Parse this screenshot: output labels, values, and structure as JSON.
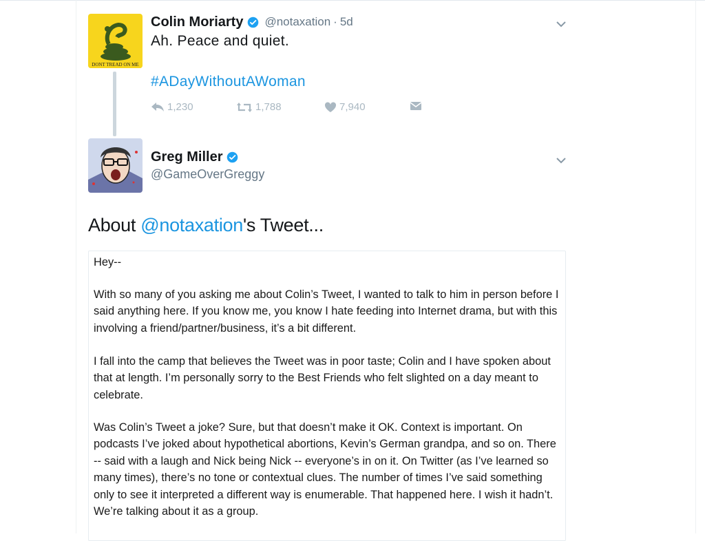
{
  "tweet": {
    "author_name": "Colin Moriarty",
    "author_handle": "@notaxation",
    "separator": "·",
    "time": "5d",
    "text": "Ah. Peace and quiet.",
    "hashtag": "#ADayWithoutAWoman",
    "avatar_caption": "DONT TREAD ON ME",
    "reply_count": "1,230",
    "retweet_count": "1,788",
    "like_count": "7,940",
    "icons": [
      "reply-icon",
      "retweet-icon",
      "like-icon",
      "direct-message-icon",
      "verified-icon",
      "chevron-down-icon"
    ]
  },
  "reply": {
    "author_name": "Greg Miller",
    "author_handle": "@GameOverGreggy"
  },
  "note": {
    "title_prefix": "About ",
    "title_mention": "@notaxation",
    "title_suffix": "'s Tweet...",
    "paragraphs": [
      "Hey--",
      "With so many of you asking me about Colin’s Tweet, I wanted to talk to him in person before I said anything here. If you know me, you know I hate feeding into Internet drama, but with this involving a friend/partner/business, it’s a bit different.",
      "I fall into the camp that believes the Tweet was in poor taste; Colin and I have spoken about that at length. I’m personally sorry to the Best Friends who felt slighted on a day meant to celebrate.",
      "Was Colin’s Tweet a joke? Sure, but that doesn’t make it OK. Context is important. On podcasts I’ve joked about hypothetical abortions, Kevin’s German grandpa, and so on. There -- said with a laugh and Nick being Nick -- everyone’s in on it. On Twitter (as I’ve learned so many times), there’s no tone or contextual clues. The number of times I’ve said something only to see it interpreted a different way is enumerable. That happened here. I wish it hadn’t. We’re talking about it as a group."
    ]
  },
  "colors": {
    "link_blue": "#1b95e0",
    "action_gray": "#aab8c2",
    "muted_text": "#657786",
    "flag_yellow": "#f7d51d"
  }
}
